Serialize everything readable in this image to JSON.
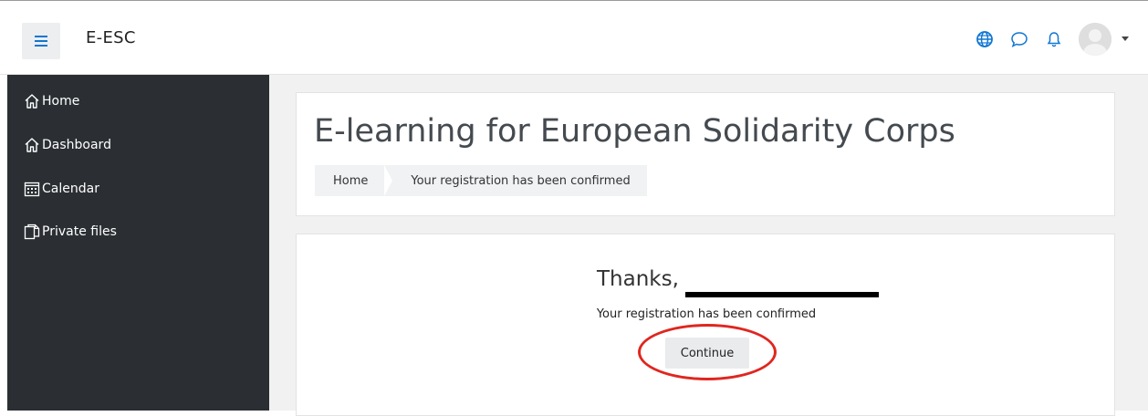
{
  "navbar": {
    "brand": "E-ESC",
    "icons": [
      "menu-icon",
      "globe-icon",
      "chat-bubble-icon",
      "bell-icon",
      "avatar",
      "chevron-down-icon"
    ]
  },
  "sidebar": {
    "items": [
      {
        "label": "Home",
        "icon": "home-icon"
      },
      {
        "label": "Dashboard",
        "icon": "home-icon"
      },
      {
        "label": "Calendar",
        "icon": "calendar-icon"
      },
      {
        "label": "Private files",
        "icon": "files-icon"
      }
    ]
  },
  "header": {
    "title": "E-learning for European Solidarity Corps",
    "breadcrumb": [
      "Home",
      "Your registration has been confirmed"
    ]
  },
  "main": {
    "thanks": "Thanks,",
    "message": "Your registration has been confirmed",
    "continue_label": "Continue"
  },
  "colors": {
    "accent": "#1177d1",
    "sidebar_bg": "#2b2f33",
    "highlight": "#e0261f"
  }
}
